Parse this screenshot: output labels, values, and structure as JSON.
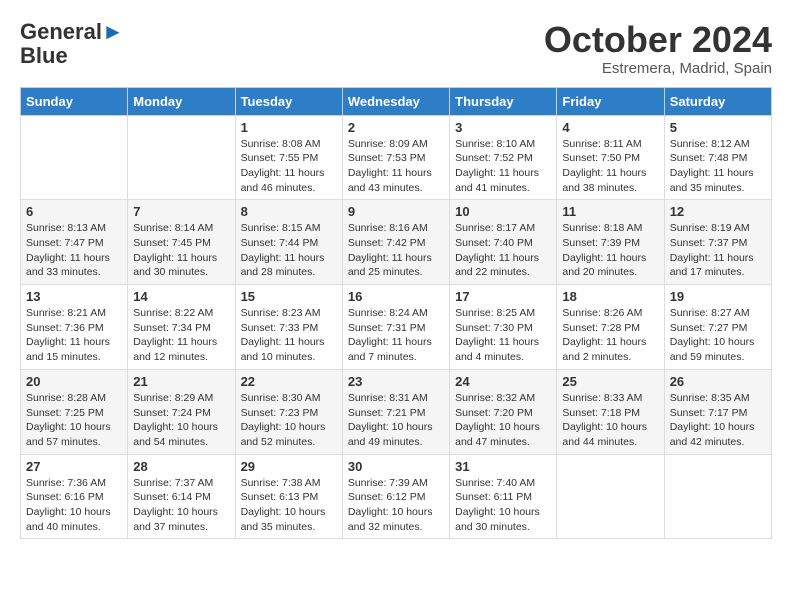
{
  "header": {
    "logo_line1": "General",
    "logo_line2": "Blue",
    "month": "October 2024",
    "location": "Estremera, Madrid, Spain"
  },
  "weekdays": [
    "Sunday",
    "Monday",
    "Tuesday",
    "Wednesday",
    "Thursday",
    "Friday",
    "Saturday"
  ],
  "weeks": [
    [
      {
        "day": "",
        "info": ""
      },
      {
        "day": "",
        "info": ""
      },
      {
        "day": "1",
        "info": "Sunrise: 8:08 AM\nSunset: 7:55 PM\nDaylight: 11 hours and 46 minutes."
      },
      {
        "day": "2",
        "info": "Sunrise: 8:09 AM\nSunset: 7:53 PM\nDaylight: 11 hours and 43 minutes."
      },
      {
        "day": "3",
        "info": "Sunrise: 8:10 AM\nSunset: 7:52 PM\nDaylight: 11 hours and 41 minutes."
      },
      {
        "day": "4",
        "info": "Sunrise: 8:11 AM\nSunset: 7:50 PM\nDaylight: 11 hours and 38 minutes."
      },
      {
        "day": "5",
        "info": "Sunrise: 8:12 AM\nSunset: 7:48 PM\nDaylight: 11 hours and 35 minutes."
      }
    ],
    [
      {
        "day": "6",
        "info": "Sunrise: 8:13 AM\nSunset: 7:47 PM\nDaylight: 11 hours and 33 minutes."
      },
      {
        "day": "7",
        "info": "Sunrise: 8:14 AM\nSunset: 7:45 PM\nDaylight: 11 hours and 30 minutes."
      },
      {
        "day": "8",
        "info": "Sunrise: 8:15 AM\nSunset: 7:44 PM\nDaylight: 11 hours and 28 minutes."
      },
      {
        "day": "9",
        "info": "Sunrise: 8:16 AM\nSunset: 7:42 PM\nDaylight: 11 hours and 25 minutes."
      },
      {
        "day": "10",
        "info": "Sunrise: 8:17 AM\nSunset: 7:40 PM\nDaylight: 11 hours and 22 minutes."
      },
      {
        "day": "11",
        "info": "Sunrise: 8:18 AM\nSunset: 7:39 PM\nDaylight: 11 hours and 20 minutes."
      },
      {
        "day": "12",
        "info": "Sunrise: 8:19 AM\nSunset: 7:37 PM\nDaylight: 11 hours and 17 minutes."
      }
    ],
    [
      {
        "day": "13",
        "info": "Sunrise: 8:21 AM\nSunset: 7:36 PM\nDaylight: 11 hours and 15 minutes."
      },
      {
        "day": "14",
        "info": "Sunrise: 8:22 AM\nSunset: 7:34 PM\nDaylight: 11 hours and 12 minutes."
      },
      {
        "day": "15",
        "info": "Sunrise: 8:23 AM\nSunset: 7:33 PM\nDaylight: 11 hours and 10 minutes."
      },
      {
        "day": "16",
        "info": "Sunrise: 8:24 AM\nSunset: 7:31 PM\nDaylight: 11 hours and 7 minutes."
      },
      {
        "day": "17",
        "info": "Sunrise: 8:25 AM\nSunset: 7:30 PM\nDaylight: 11 hours and 4 minutes."
      },
      {
        "day": "18",
        "info": "Sunrise: 8:26 AM\nSunset: 7:28 PM\nDaylight: 11 hours and 2 minutes."
      },
      {
        "day": "19",
        "info": "Sunrise: 8:27 AM\nSunset: 7:27 PM\nDaylight: 10 hours and 59 minutes."
      }
    ],
    [
      {
        "day": "20",
        "info": "Sunrise: 8:28 AM\nSunset: 7:25 PM\nDaylight: 10 hours and 57 minutes."
      },
      {
        "day": "21",
        "info": "Sunrise: 8:29 AM\nSunset: 7:24 PM\nDaylight: 10 hours and 54 minutes."
      },
      {
        "day": "22",
        "info": "Sunrise: 8:30 AM\nSunset: 7:23 PM\nDaylight: 10 hours and 52 minutes."
      },
      {
        "day": "23",
        "info": "Sunrise: 8:31 AM\nSunset: 7:21 PM\nDaylight: 10 hours and 49 minutes."
      },
      {
        "day": "24",
        "info": "Sunrise: 8:32 AM\nSunset: 7:20 PM\nDaylight: 10 hours and 47 minutes."
      },
      {
        "day": "25",
        "info": "Sunrise: 8:33 AM\nSunset: 7:18 PM\nDaylight: 10 hours and 44 minutes."
      },
      {
        "day": "26",
        "info": "Sunrise: 8:35 AM\nSunset: 7:17 PM\nDaylight: 10 hours and 42 minutes."
      }
    ],
    [
      {
        "day": "27",
        "info": "Sunrise: 7:36 AM\nSunset: 6:16 PM\nDaylight: 10 hours and 40 minutes."
      },
      {
        "day": "28",
        "info": "Sunrise: 7:37 AM\nSunset: 6:14 PM\nDaylight: 10 hours and 37 minutes."
      },
      {
        "day": "29",
        "info": "Sunrise: 7:38 AM\nSunset: 6:13 PM\nDaylight: 10 hours and 35 minutes."
      },
      {
        "day": "30",
        "info": "Sunrise: 7:39 AM\nSunset: 6:12 PM\nDaylight: 10 hours and 32 minutes."
      },
      {
        "day": "31",
        "info": "Sunrise: 7:40 AM\nSunset: 6:11 PM\nDaylight: 10 hours and 30 minutes."
      },
      {
        "day": "",
        "info": ""
      },
      {
        "day": "",
        "info": ""
      }
    ]
  ]
}
